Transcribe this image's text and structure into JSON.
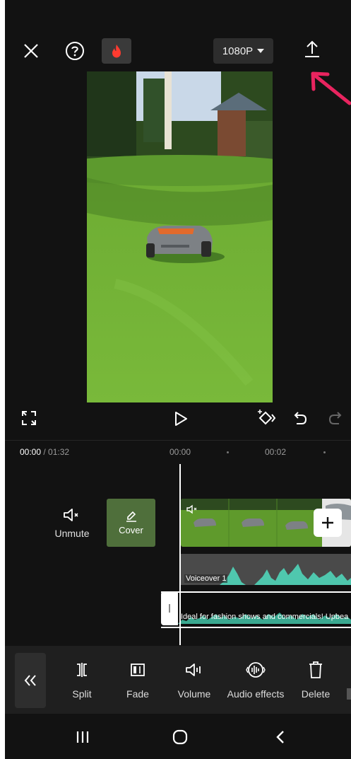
{
  "header": {
    "resolution_label": "1080P"
  },
  "editor": {
    "current_time": "00:00",
    "total_time": "/ 01:32",
    "ruler": [
      "00:00",
      "00:02"
    ]
  },
  "timeline": {
    "unmute_label": "Unmute",
    "cover_label": "Cover",
    "voiceover_label": "Voiceover 1",
    "music_label": "Ideal for fashion shows and commercials! Upbea"
  },
  "toolbar": {
    "items": [
      {
        "label": "Split",
        "icon": "split-icon"
      },
      {
        "label": "Fade",
        "icon": "fade-icon"
      },
      {
        "label": "Volume",
        "icon": "volume-icon"
      },
      {
        "label": "Audio effects",
        "icon": "audio-effects-icon"
      },
      {
        "label": "Delete",
        "icon": "delete-icon"
      }
    ]
  },
  "colors": {
    "background": "#121212",
    "accent_arrow": "#e8245f",
    "fire_icon": "#ff3b30",
    "waveform": "#4fc7ae"
  }
}
